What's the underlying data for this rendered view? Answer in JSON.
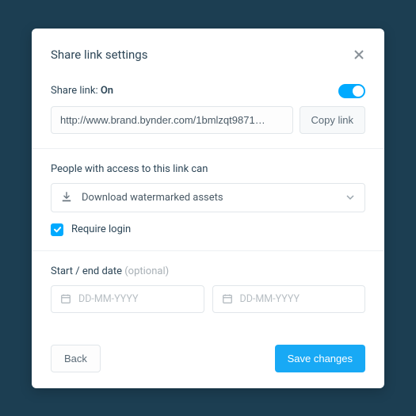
{
  "modal": {
    "title": "Share link settings"
  },
  "sharelink": {
    "label": "Share link: ",
    "state": "On",
    "url": "http://www.brand.bynder.com/1bmlzqt9871…",
    "copy_label": "Copy link"
  },
  "access": {
    "label": "People with access to this link can",
    "selected": "Download watermarked assets"
  },
  "require_login": {
    "label": "Require login",
    "checked": true
  },
  "dates": {
    "label_main": "Start / end date ",
    "label_optional": "(optional)",
    "start_placeholder": "DD-MM-YYYY",
    "end_placeholder": "DD-MM-YYYY"
  },
  "footer": {
    "back": "Back",
    "save": "Save changes"
  },
  "colors": {
    "accent": "#00aaff",
    "primary_button": "#18a9f5"
  }
}
